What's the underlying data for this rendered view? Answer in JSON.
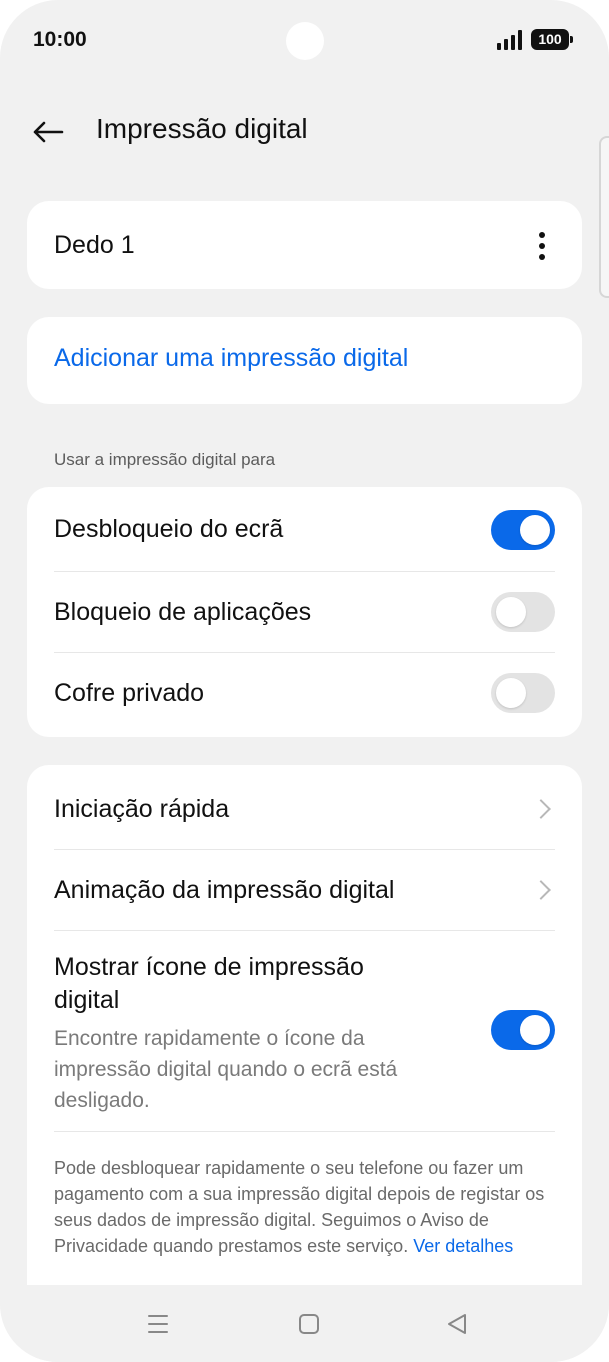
{
  "status_bar": {
    "time": "10:00",
    "battery": "100",
    "icons": [
      "signal-icon",
      "battery-icon"
    ]
  },
  "header": {
    "title": "Impressão digital",
    "back_icon": "arrow-left-icon"
  },
  "fingerprints": {
    "items": [
      {
        "label": "Dedo 1",
        "menu_icon": "more-vertical-icon"
      }
    ]
  },
  "add_fingerprint": {
    "label": "Adicionar uma impressão digital"
  },
  "usage": {
    "section_label": "Usar a impressão digital para",
    "items": [
      {
        "label": "Desbloqueio do ecrã",
        "enabled": true
      },
      {
        "label": "Bloqueio de aplicações",
        "enabled": false
      },
      {
        "label": "Cofre privado",
        "enabled": false
      }
    ]
  },
  "more_settings": {
    "items": [
      {
        "label": "Iniciação rápida",
        "icon": "chevron-right-icon"
      },
      {
        "label": "Animação da impressão digital",
        "icon": "chevron-right-icon"
      }
    ],
    "show_icon": {
      "title": "Mostrar ícone de impressão digital",
      "description": "Encontre rapidamente o ícone da impressão digital quando o ecrã está desligado.",
      "enabled": true
    },
    "footer": {
      "text": "Pode desbloquear rapidamente o seu telefone ou fazer um pagamento com a sua impressão digital depois de registar os seus dados de impressão digital. Seguimos o Aviso de Privacidade quando prestamos este serviço.",
      "link": "Ver detalhes"
    }
  },
  "nav_bar": {
    "icons": [
      "menu-icon",
      "home-icon",
      "back-triangle-icon"
    ]
  },
  "colors": {
    "accent": "#0a69e9",
    "background": "#f1f1f1",
    "card": "#ffffff",
    "toggle_off": "#e3e3e3"
  }
}
